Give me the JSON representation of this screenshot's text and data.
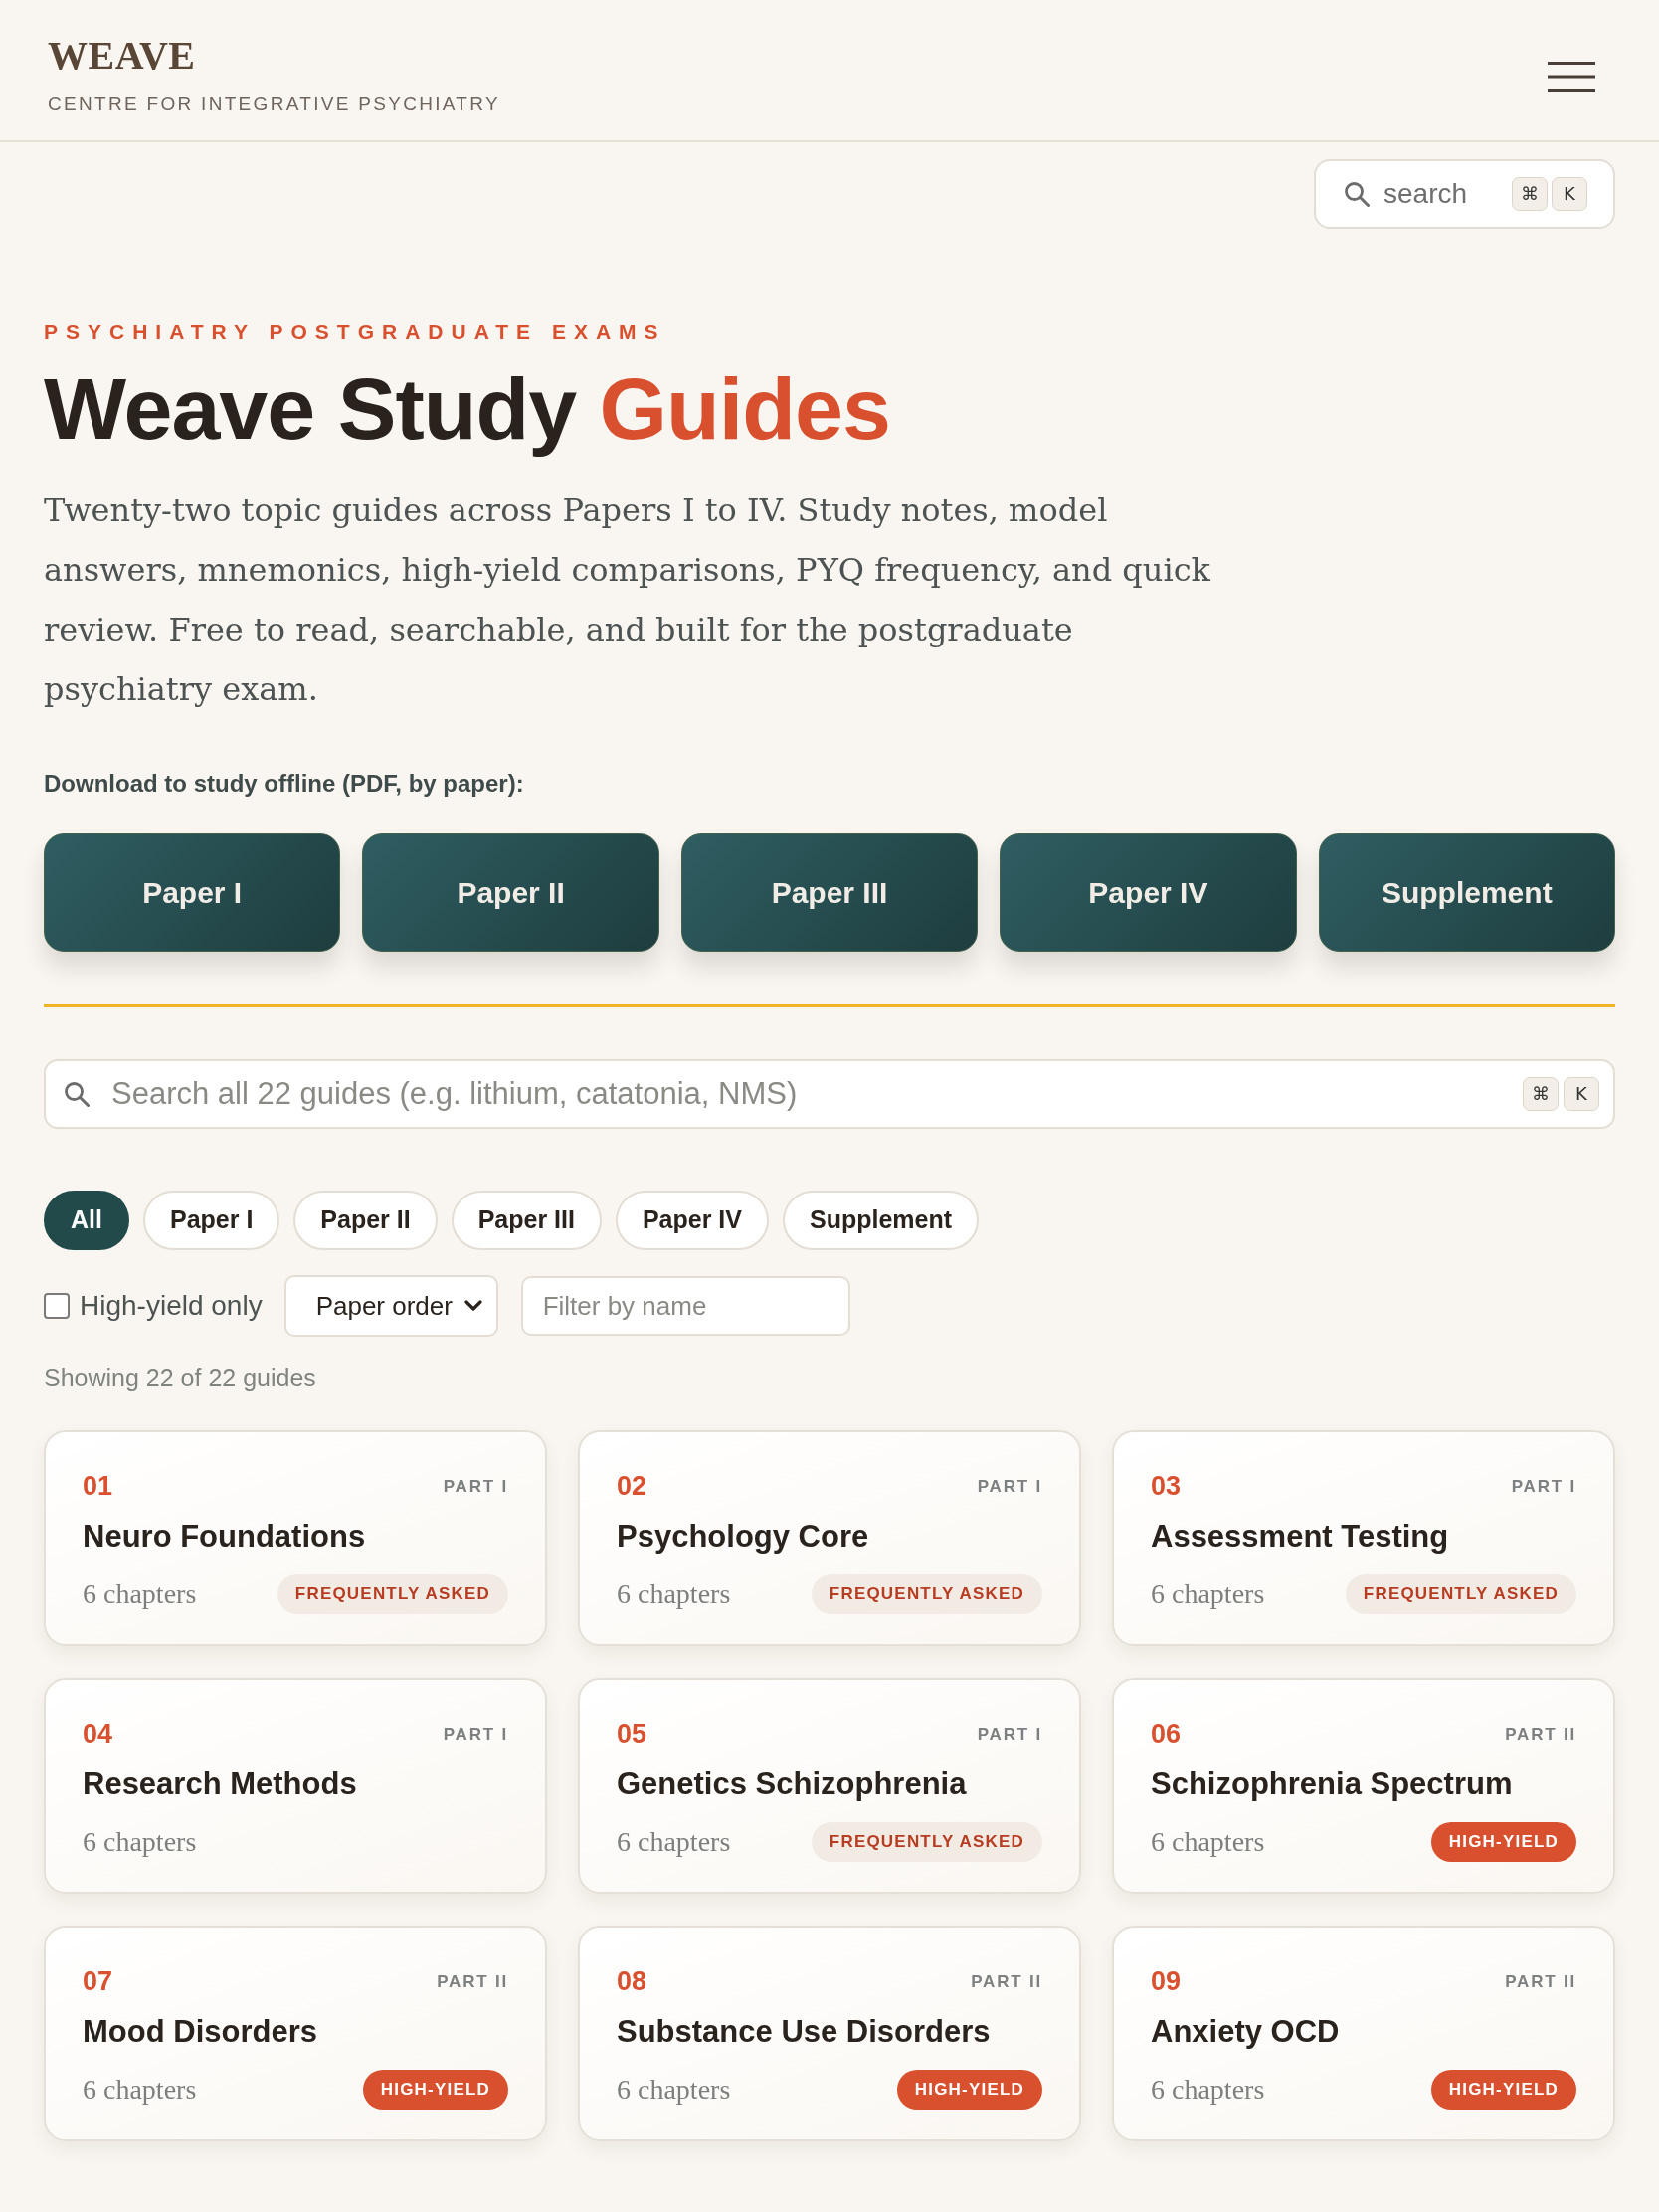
{
  "header": {
    "logo": "WEAVE",
    "tagline": "CENTRE FOR INTEGRATIVE PSYCHIATRY"
  },
  "search_button": {
    "label": "search",
    "keys": [
      "⌘",
      "K"
    ]
  },
  "hero": {
    "eyebrow": "PSYCHIATRY POSTGRADUATE EXAMS",
    "title": "Weave Study",
    "title_accent": "Guides",
    "description": "Twenty-two topic guides across Papers I to IV. Study notes, model answers, mnemonics, high-yield comparisons, PYQ frequency, and quick review. Free to read, searchable, and built for the postgraduate psychiatry exam.",
    "download_label": "Download to study offline (PDF, by paper):"
  },
  "downloads": [
    "Paper I",
    "Paper II",
    "Paper III",
    "Paper IV",
    "Supplement"
  ],
  "guide_search": {
    "placeholder": "Search all 22 guides (e.g. lithium, catatonia, NMS)",
    "keys": [
      "⌘",
      "K"
    ]
  },
  "filters": [
    {
      "label": "All",
      "selected": true
    },
    {
      "label": "Paper I",
      "selected": false
    },
    {
      "label": "Paper II",
      "selected": false
    },
    {
      "label": "Paper III",
      "selected": false
    },
    {
      "label": "Paper IV",
      "selected": false
    },
    {
      "label": "Supplement",
      "selected": false
    }
  ],
  "high_yield_only": {
    "label": "High-yield only",
    "checked": false
  },
  "sort": {
    "value": "Paper order"
  },
  "name_filter": {
    "placeholder": "Filter by name"
  },
  "result_count": "Showing 22 of 22 guides",
  "guides": [
    {
      "number": "01",
      "part": "PART I",
      "title": "Neuro Foundations",
      "chapters": "6 chapters",
      "badge": {
        "kind": "frequent",
        "label": "FREQUENTLY ASKED"
      }
    },
    {
      "number": "02",
      "part": "PART I",
      "title": "Psychology Core",
      "chapters": "6 chapters",
      "badge": {
        "kind": "frequent",
        "label": "FREQUENTLY ASKED"
      }
    },
    {
      "number": "03",
      "part": "PART I",
      "title": "Assessment Testing",
      "chapters": "6 chapters",
      "badge": {
        "kind": "frequent",
        "label": "FREQUENTLY ASKED"
      }
    },
    {
      "number": "04",
      "part": "PART I",
      "title": "Research Methods",
      "chapters": "6 chapters"
    },
    {
      "number": "05",
      "part": "PART I",
      "title": "Genetics Schizophrenia",
      "chapters": "6 chapters",
      "badge": {
        "kind": "frequent",
        "label": "FREQUENTLY ASKED"
      }
    },
    {
      "number": "06",
      "part": "PART II",
      "title": "Schizophrenia Spectrum",
      "chapters": "6 chapters",
      "badge": {
        "kind": "high",
        "label": "HIGH-YIELD"
      }
    },
    {
      "number": "07",
      "part": "PART II",
      "title": "Mood Disorders",
      "chapters": "6 chapters",
      "badge": {
        "kind": "high",
        "label": "HIGH-YIELD"
      }
    },
    {
      "number": "08",
      "part": "PART II",
      "title": "Substance Use Disorders",
      "chapters": "6 chapters",
      "badge": {
        "kind": "high",
        "label": "HIGH-YIELD"
      }
    },
    {
      "number": "09",
      "part": "PART II",
      "title": "Anxiety OCD",
      "chapters": "6 chapters",
      "badge": {
        "kind": "high",
        "label": "HIGH-YIELD"
      }
    }
  ]
}
